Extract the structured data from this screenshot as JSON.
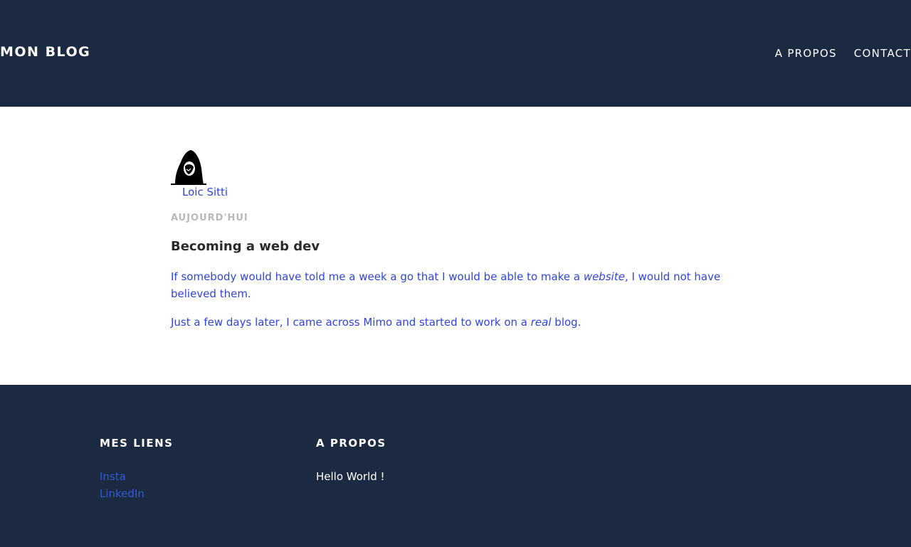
{
  "header": {
    "brand": "MON BLOG",
    "nav": [
      {
        "label": "A PROPOS"
      },
      {
        "label": "CONTACT"
      }
    ]
  },
  "post": {
    "author": "Loic Sitti",
    "date": "AUJOURD'HUI",
    "title": "Becoming a web dev",
    "paragraph1": {
      "before": "If somebody would have told me a week a go that I would be able to make a ",
      "emphasis": "website",
      "after": ", I would not have believed them."
    },
    "paragraph2": {
      "before": "Just a few days later, I came across Mimo and started to work on a ",
      "emphasis": "real",
      "after": " blog."
    }
  },
  "footer": {
    "links_heading": "MES LIENS",
    "links": [
      {
        "label": "Insta"
      },
      {
        "label": "LinkedIn"
      }
    ],
    "about_heading": "A PROPOS",
    "about_text": "Hello World !"
  },
  "icons": {
    "avatar": "hooded-figure-avatar"
  },
  "colors": {
    "header_bg": "#1b2a40",
    "link": "#2f46d6",
    "date": "#b8b8b8",
    "title": "#2a2a2a"
  }
}
